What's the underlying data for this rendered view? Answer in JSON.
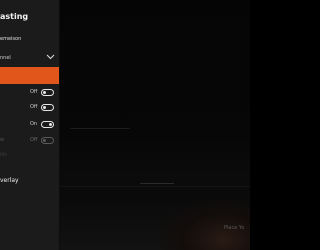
{
  "panel": {
    "title": "asting",
    "user_name": "emeison",
    "channel_label": "nnel",
    "toggles": [
      {
        "state_label": "Off",
        "value": "off",
        "enabled": true
      },
      {
        "state_label": "Off",
        "value": "off",
        "enabled": true
      },
      {
        "state_label": "On",
        "value": "on",
        "enabled": true
      },
      {
        "state_label": "Off",
        "value": "off",
        "enabled": false,
        "label_fragment": "w"
      }
    ],
    "faint_row_label": "ilin",
    "overlay_label": "verlay",
    "accent_color": "#e0561b"
  },
  "game_view": {
    "hint_text": "Place Yo"
  },
  "icons": {
    "channel_dropdown": "chevron-down-icon"
  }
}
